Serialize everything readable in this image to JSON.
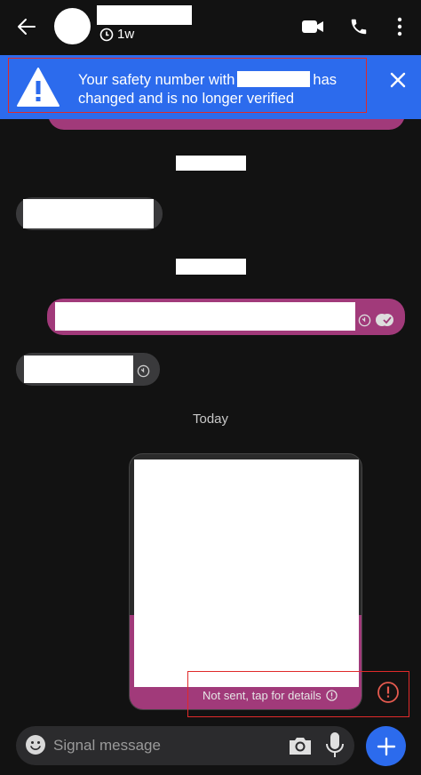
{
  "header": {
    "disappearing_timer": "1w"
  },
  "banner": {
    "text_before": "Your safety number with",
    "text_after": "has",
    "line2": "changed and is no longer verified"
  },
  "conversation": {
    "date_divider": "Today",
    "failed_message_status": "Not sent, tap for details"
  },
  "composer": {
    "placeholder": "Signal message"
  },
  "colors": {
    "background": "#121212",
    "banner_blue": "#2c6bed",
    "outgoing_bubble": "#a13a7a",
    "incoming_bubble": "#3a3a3c",
    "error_red": "#e02a2a"
  }
}
